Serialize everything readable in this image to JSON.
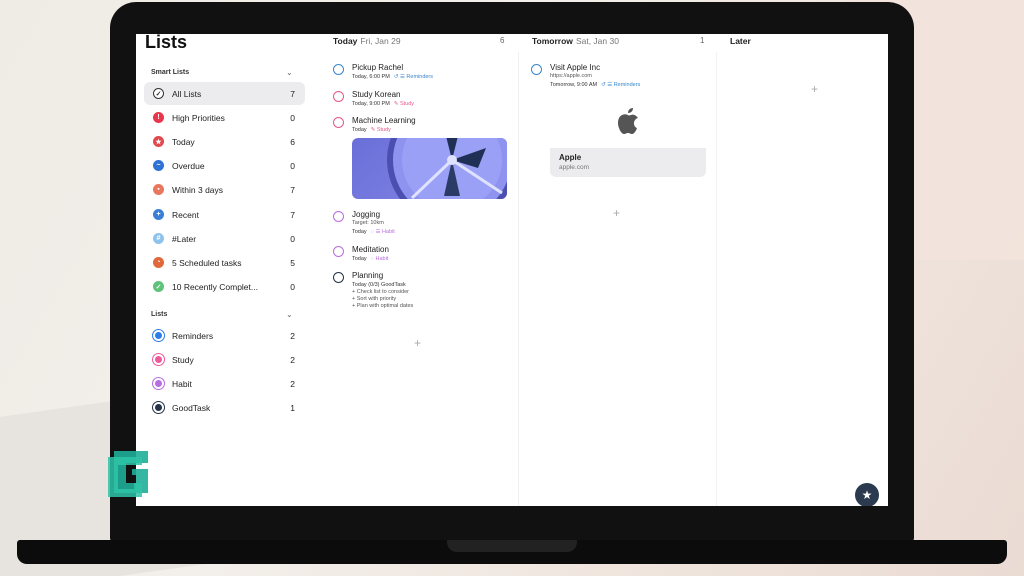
{
  "app": {
    "title": "Lists"
  },
  "sidebar": {
    "smart_header": "Smart Lists",
    "lists_header": "Lists",
    "smart_items": [
      {
        "label": "All Lists",
        "count": "7",
        "color": "#ffffff",
        "icon": "check-circle-icon"
      },
      {
        "label": "High Priorities",
        "count": "0",
        "color": "#e8364c",
        "icon": "exclamation-icon"
      },
      {
        "label": "Today",
        "count": "6",
        "color": "#e0484d",
        "icon": "star-icon"
      },
      {
        "label": "Overdue",
        "count": "0",
        "color": "#2f72d6",
        "icon": "wave-icon"
      },
      {
        "label": "Within 3 days",
        "count": "7",
        "color": "#e9775e",
        "icon": "calendar-icon"
      },
      {
        "label": "Recent",
        "count": "7",
        "color": "#3a7fd6",
        "icon": "plus-icon"
      },
      {
        "label": "#Later",
        "count": "0",
        "color": "#8fc3ec",
        "icon": "hash-icon"
      },
      {
        "label": "5 Scheduled tasks",
        "count": "5",
        "color": "#e0683a",
        "icon": "clock-icon"
      },
      {
        "label": "10 Recently Complet...",
        "count": "0",
        "color": "#5fc27a",
        "icon": "check-icon"
      }
    ],
    "list_items": [
      {
        "label": "Reminders",
        "count": "2",
        "color": "#2d7ee6"
      },
      {
        "label": "Study",
        "count": "2",
        "color": "#ef5a9a"
      },
      {
        "label": "Habit",
        "count": "2",
        "color": "#b86de0"
      },
      {
        "label": "GoodTask",
        "count": "1",
        "color": "#263247"
      }
    ]
  },
  "columns": {
    "today": {
      "title": "Today",
      "date": "Fri, Jan 29",
      "count": "6"
    },
    "tomorrow": {
      "title": "Tomorrow",
      "date": "Sat, Jan 30",
      "count": "1"
    },
    "later": {
      "title": "Later"
    }
  },
  "tasks_today": [
    {
      "title": "Pickup Rachel",
      "meta": "Today, 6:00 PM",
      "tag": "Reminders",
      "color": "#3a86c8"
    },
    {
      "title": "Study Korean",
      "meta": "Today, 9:00 PM",
      "tag": "Study",
      "color": "#e5578d"
    },
    {
      "title": "Machine Learning",
      "meta": "Today",
      "tag": "Study",
      "color": "#e5578d"
    },
    {
      "title": "Jogging",
      "sub": "Target: 10km",
      "meta": "Today",
      "tag": "Habit",
      "color": "#b86de0"
    },
    {
      "title": "Meditation",
      "meta": "Today",
      "tag": "Habit",
      "color": "#b86de0"
    },
    {
      "title": "Planning",
      "meta": "Today (0/3) GoodTask",
      "color": "#263247",
      "notes": [
        "+ Check list to consider",
        "+ Sort with priority",
        "+ Plan with optimal dates"
      ]
    }
  ],
  "tasks_tomorrow": [
    {
      "title": "Visit Apple Inc",
      "sub": "https://apple.com",
      "meta": "Tomorrow, 9:00 AM",
      "tag": "Reminders",
      "color": "#3a86c8"
    }
  ],
  "link_card": {
    "title": "Apple",
    "url": "apple.com"
  }
}
